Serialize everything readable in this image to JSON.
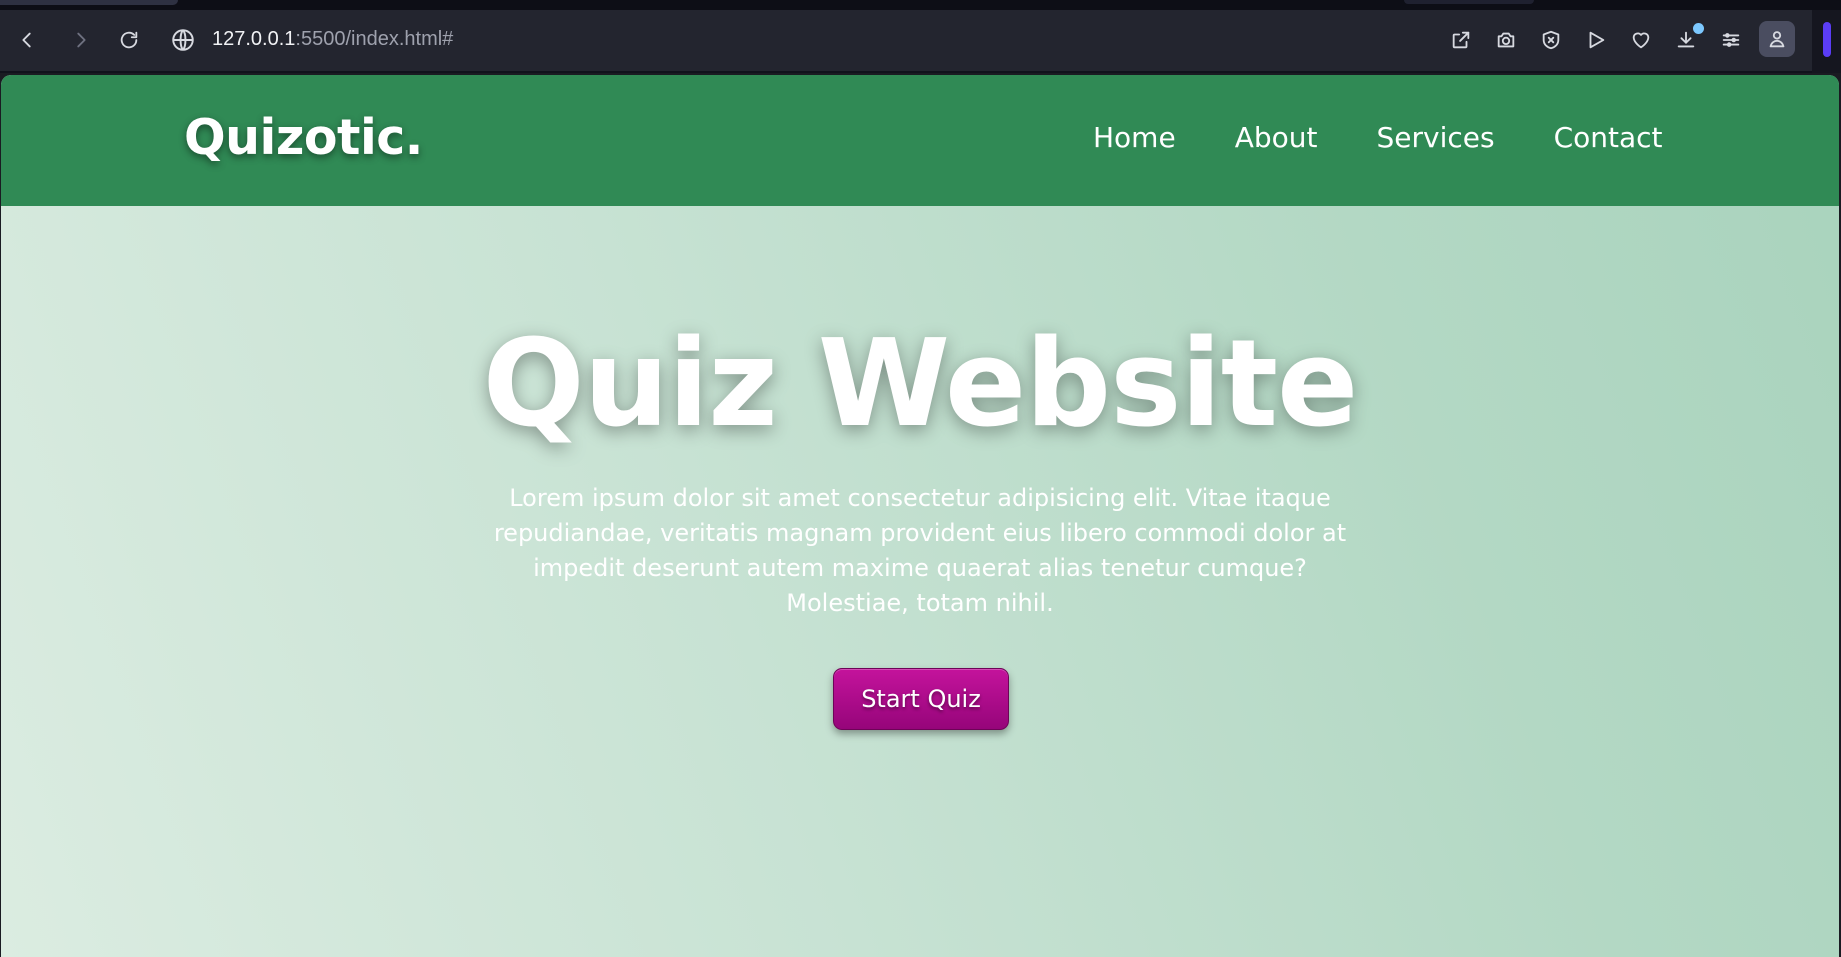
{
  "browser": {
    "url_host": "127.0.0.1",
    "url_rest": ":5500/index.html#",
    "toolbar_icons": [
      "back-icon",
      "forward-icon",
      "reload-icon",
      "globe-icon",
      "share-icon",
      "camera-icon",
      "shield-icon",
      "send-icon",
      "heart-icon",
      "download-icon",
      "menu-icon",
      "profile-icon"
    ]
  },
  "site": {
    "logo": "Quizotic.",
    "nav": [
      {
        "label": "Home"
      },
      {
        "label": "About"
      },
      {
        "label": "Services"
      },
      {
        "label": "Contact"
      }
    ]
  },
  "hero": {
    "title": "Quiz Website",
    "description": "Lorem ipsum dolor sit amet consectetur adipisicing elit. Vitae itaque repudiandae, veritatis magnam provident eius libero commodi dolor at impedit deserunt autem maxime quaerat alias tenetur cumque? Molestiae, totam nihil.",
    "button_label": "Start Quiz"
  },
  "colors": {
    "nav_bg": "#308a55",
    "button": "#b00c8f",
    "scroll_thumb": "#5b3df5"
  }
}
